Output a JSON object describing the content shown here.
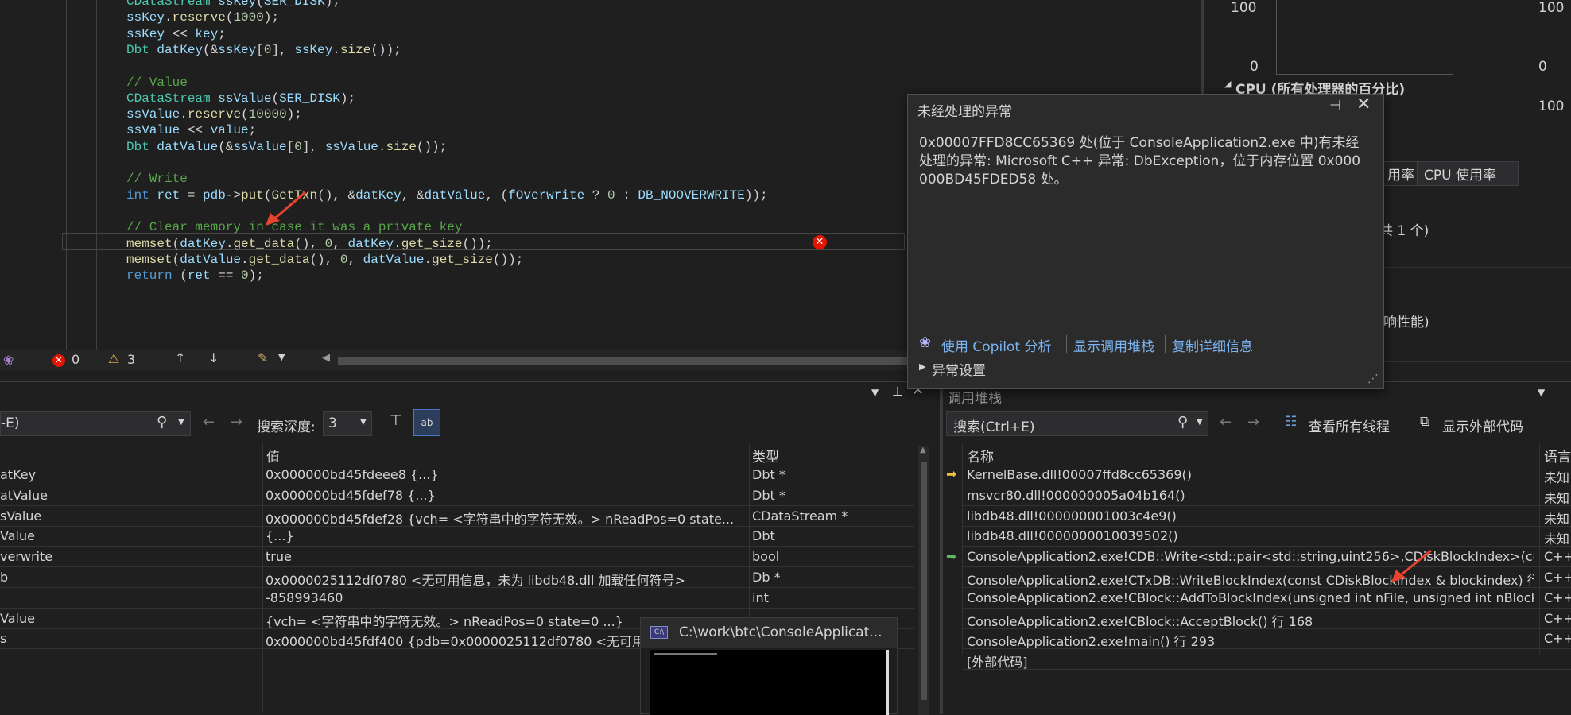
{
  "code": {
    "lines": [
      "CDataStream ssKey(SER_DISK);",
      "ssKey.reserve(1000);",
      "ssKey << key;",
      "Dbt datKey(&ssKey[0], ssKey.size());",
      "",
      "// Value",
      "CDataStream ssValue(SER_DISK);",
      "ssValue.reserve(10000);",
      "ssValue << value;",
      "Dbt datValue(&ssValue[0], ssValue.size());",
      "",
      "// Write",
      "int ret = pdb->put(GetTxn(), &datKey, &datValue, (fOverwrite ? 0 : DB_NOOVERWRITE));",
      "",
      "// Clear memory in case it was a private key",
      "memset(datKey.get_data(), 0, datKey.get_size());",
      "memset(datValue.get_data(), 0, datValue.get_size());",
      "return (ret == 0);"
    ]
  },
  "status": {
    "errors": "0",
    "warnings": "3"
  },
  "exception_popup": {
    "title": "未经处理的异常",
    "message": "0x00007FFD8CC65369 处(位于 ConsoleApplication2.exe 中)有未经处理的异常: Microsoft C++ 异常: DbException，位于内存位置 0x000000BD45FDED58 处。",
    "copilot_link": "使用 Copilot 分析",
    "callstack_link": "显示调用堆栈",
    "copy_link": "复制详细信息",
    "settings": "异常设置"
  },
  "locals": {
    "search_value": "-E)",
    "search_depth_label": "搜索深度:",
    "search_depth_value": "3",
    "columns": [
      "值",
      "类型"
    ],
    "rows": [
      {
        "name": "atKey",
        "value": "0x000000bd45fdeee8 {...}",
        "type": "Dbt *"
      },
      {
        "name": "atValue",
        "value": "0x000000bd45fdef78 {...}",
        "type": "Dbt *"
      },
      {
        "name": "sValue",
        "value": "0x000000bd45fdef28 {vch= <字符串中的字符无效。> nReadPos=0 state...",
        "type": "CDataStream *"
      },
      {
        "name": "Value",
        "value": "{...}",
        "type": "Dbt"
      },
      {
        "name": "verwrite",
        "value": "true",
        "type": "bool"
      },
      {
        "name": "b",
        "value": "0x0000025112df0780 <无可用信息，未为 libdb48.dll 加载任何符号>",
        "type": "Db *"
      },
      {
        "name": "",
        "value": "-858993460",
        "type": "int"
      },
      {
        "name": "Value",
        "value": "{vch= <字符串中的字符无效。> nReadPos=0 state=0 ...}",
        "type": ""
      },
      {
        "name": "s",
        "value": "0x000000bd45fdf400 {pdb=0x0000025112df0780 <无可用",
        "type": ""
      }
    ]
  },
  "callstack": {
    "title": "调用堆栈",
    "search_placeholder": "搜索(Ctrl+E)",
    "view_threads": "查看所有线程",
    "show_external": "显示外部代码",
    "columns": [
      "名称",
      "语言"
    ],
    "rows": [
      {
        "name": "KernelBase.dll!00007ffd8cc65369()",
        "lang": "未知"
      },
      {
        "name": "msvcr80.dll!000000005a04b164()",
        "lang": "未知"
      },
      {
        "name": "libdb48.dll!000000001003c4e9()",
        "lang": "未知"
      },
      {
        "name": "libdb48.dll!0000000010039502()",
        "lang": "未知"
      },
      {
        "name": "ConsoleApplication2.exe!CDB::Write<std::pair<std::string,uint256>,CDiskBlockIndex>(con...",
        "lang": "C++"
      },
      {
        "name": "ConsoleApplication2.exe!CTxDB::WriteBlockIndex(const CDiskBlockIndex & blockindex) 行 ...",
        "lang": "C++"
      },
      {
        "name": "ConsoleApplication2.exe!CBlock::AddToBlockIndex(unsigned int nFile, unsigned int nBlock...",
        "lang": "C++"
      },
      {
        "name": "ConsoleApplication2.exe!CBlock::AcceptBlock() 行 168",
        "lang": "C++"
      },
      {
        "name": "ConsoleApplication2.exe!main() 行 293",
        "lang": "C++"
      },
      {
        "name": "[外部代码]",
        "lang": ""
      }
    ]
  },
  "perf": {
    "label_100a": "100",
    "label_100b": "100",
    "label_0a": "0",
    "label_0b": "0",
    "cpu_title": "CPU (所有处理器的百分比)",
    "label_100c": "100",
    "tab1": "用率",
    "tab2": "CPU 使用率",
    "text1": "共 1 个)",
    "text2": "响性能)"
  },
  "console_window": {
    "title": "C:\\work\\btc\\ConsoleApplicat..."
  }
}
